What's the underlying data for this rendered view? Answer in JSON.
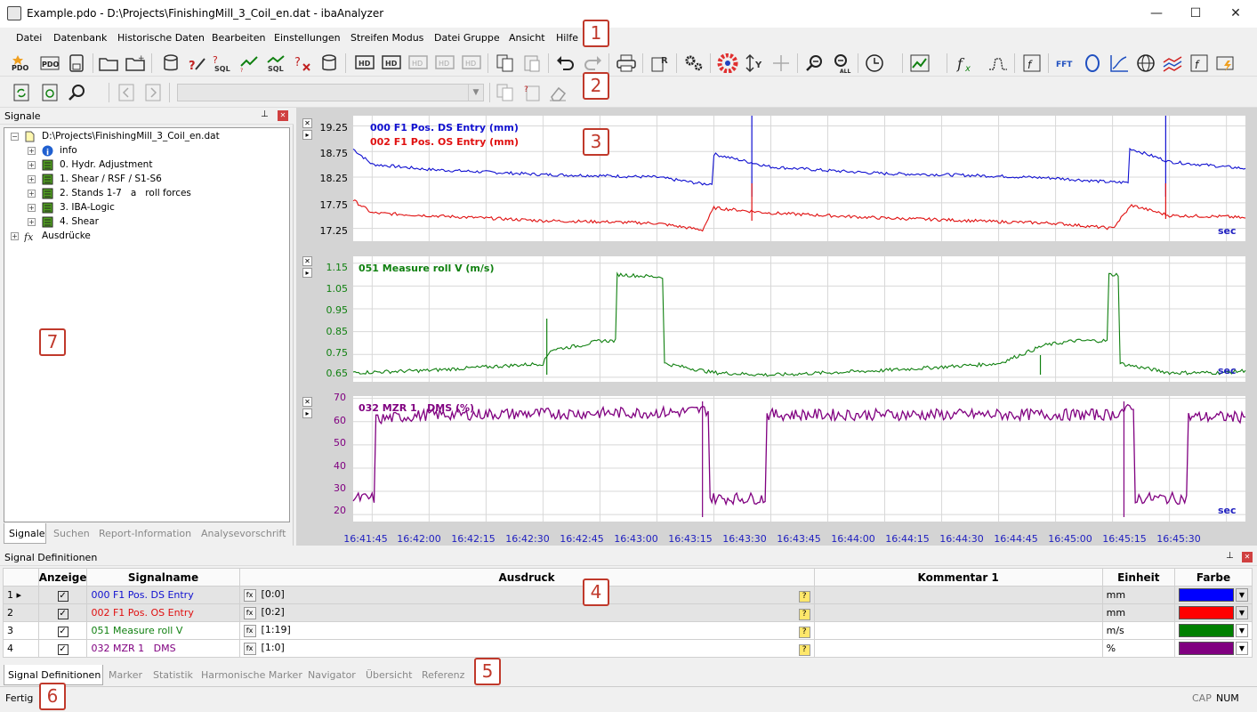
{
  "window": {
    "title": "Example.pdo - D:\\Projects\\FinishingMill_3_Coil_en.dat - ibaAnalyzer",
    "minimize": "—",
    "maximize": "☐",
    "close": "✕"
  },
  "menu": [
    "Datei",
    "Datenbank",
    "Historische Daten",
    "Bearbeiten",
    "Einstellungen",
    "Streifen Modus",
    "Datei Gruppe",
    "Ansicht",
    "Hilfe"
  ],
  "callouts": [
    "1",
    "2",
    "3",
    "4",
    "5",
    "6",
    "7"
  ],
  "signals_panel": {
    "title": "Signale",
    "pin": "⊥",
    "close": "✕",
    "root": "D:\\Projects\\FinishingMill_3_Coil_en.dat",
    "items": [
      "info",
      "0. Hydr. Adjustment",
      "1. Shear / RSF / S1-S6",
      "2. Stands 1-7   a   roll forces",
      "3. IBA-Logic",
      "4. Shear"
    ],
    "expressions": "Ausdrücke",
    "tabs": [
      "Signale",
      "Suchen",
      "Report-Information",
      "Analysevorschrift"
    ]
  },
  "charts": {
    "colors": {
      "blue": "#1010d0",
      "red": "#e01010",
      "green": "#108010",
      "purple": "#800080"
    },
    "sec_label": "sec",
    "x_ticks": [
      "16:41:45",
      "16:42:00",
      "16:42:15",
      "16:42:30",
      "16:42:45",
      "16:43:00",
      "16:43:15",
      "16:43:30",
      "16:43:45",
      "16:44:00",
      "16:44:15",
      "16:44:30",
      "16:44:45",
      "16:45:00",
      "16:45:15",
      "16:45:30"
    ],
    "chart1": {
      "y_ticks": [
        "19.25",
        "18.75",
        "18.25",
        "17.75",
        "17.25"
      ],
      "legend": [
        "000 F1 Pos. DS Entry (mm)",
        "002 F1 Pos. OS Entry (mm)"
      ]
    },
    "chart2": {
      "y_ticks": [
        "1.15",
        "1.05",
        "0.95",
        "0.85",
        "0.75",
        "0.65"
      ],
      "legend": [
        "051 Measure roll V (m/s)"
      ]
    },
    "chart3": {
      "y_ticks": [
        "70",
        "60",
        "50",
        "40",
        "30",
        "20"
      ],
      "legend": [
        "032 MZR 1   DMS (%)"
      ]
    }
  },
  "chart_data": [
    {
      "type": "line",
      "title": "",
      "xlabel": "",
      "ylabel": "",
      "ylim": [
        17.0,
        19.45
      ],
      "y_ticks": [
        19.25,
        18.75,
        18.25,
        17.75,
        17.25
      ],
      "x": [
        "16:41:40",
        "16:41:45",
        "16:42:00",
        "16:42:15",
        "16:42:30",
        "16:42:45",
        "16:43:00",
        "16:43:12",
        "16:43:15",
        "16:43:30",
        "16:43:45",
        "16:44:00",
        "16:44:15",
        "16:44:30",
        "16:44:45",
        "16:45:00",
        "16:45:05",
        "16:45:15",
        "16:45:30",
        "16:45:35"
      ],
      "series": [
        {
          "name": "000 F1 Pos. DS Entry (mm)",
          "values": [
            18.8,
            18.5,
            18.4,
            18.35,
            18.3,
            18.28,
            18.25,
            18.12,
            18.7,
            18.45,
            18.38,
            18.32,
            18.3,
            18.27,
            18.23,
            18.15,
            18.8,
            18.55,
            18.45,
            18.42
          ]
        },
        {
          "name": "002 F1 Pos. OS Entry (mm)",
          "values": [
            17.8,
            17.55,
            17.5,
            17.45,
            17.4,
            17.38,
            17.35,
            17.22,
            17.65,
            17.55,
            17.5,
            17.45,
            17.42,
            17.38,
            17.35,
            17.25,
            17.7,
            17.5,
            17.48,
            17.45
          ]
        }
      ]
    },
    {
      "type": "line",
      "title": "",
      "xlabel": "",
      "ylabel": "",
      "ylim": [
        0.63,
        1.18
      ],
      "y_ticks": [
        1.15,
        1.05,
        0.95,
        0.85,
        0.75,
        0.65
      ],
      "x": [
        "16:41:40",
        "16:42:00",
        "16:42:30",
        "16:42:32",
        "16:42:40",
        "16:42:45",
        "16:42:50",
        "16:43:00",
        "16:43:02",
        "16:43:15",
        "16:43:30",
        "16:44:00",
        "16:44:30",
        "16:44:42",
        "16:44:50",
        "16:45:00",
        "16:45:02",
        "16:45:15",
        "16:45:30",
        "16:45:35"
      ],
      "series": [
        {
          "name": "051 Measure roll V (m/s)",
          "values": [
            0.67,
            0.68,
            0.71,
            0.77,
            0.79,
            0.81,
            1.1,
            1.09,
            0.71,
            0.67,
            0.66,
            0.68,
            0.71,
            0.79,
            0.81,
            1.1,
            0.71,
            0.67,
            0.67,
            0.68
          ]
        }
      ]
    },
    {
      "type": "line",
      "title": "",
      "xlabel": "",
      "ylabel": "",
      "ylim": [
        17,
        71
      ],
      "y_ticks": [
        70,
        60,
        50,
        40,
        30,
        20
      ],
      "x": [
        "16:41:40",
        "16:41:45",
        "16:41:46",
        "16:42:00",
        "16:43:05",
        "16:43:12",
        "16:43:14",
        "16:43:28",
        "16:43:29",
        "16:44:00",
        "16:45:00",
        "16:45:03",
        "16:45:06",
        "16:45:19",
        "16:45:20",
        "16:45:35"
      ],
      "series": [
        {
          "name": "032 MZR 1   DMS (%)",
          "values": [
            27,
            27,
            61,
            63,
            64,
            65,
            27,
            27,
            63,
            63,
            63,
            65,
            27,
            27,
            62,
            62
          ]
        }
      ]
    }
  ],
  "definitions": {
    "title": "Signal Definitionen",
    "pin": "⊥",
    "close": "✕",
    "columns": [
      "Anzeige",
      "Signalname",
      "Ausdruck",
      "Kommentar 1",
      "Einheit",
      "Farbe"
    ],
    "rows": [
      {
        "idx": "1 ▸",
        "check": "✓",
        "name": "000 F1 Pos. DS Entry",
        "fx": "fx",
        "expr": "[0:0]",
        "q": "?",
        "comment": "",
        "unit": "mm",
        "color": "#0000ff",
        "textcolor": "#1010d0"
      },
      {
        "idx": "2",
        "check": "✓",
        "name": "002 F1 Pos. OS Entry",
        "fx": "fx",
        "expr": "[0:2]",
        "q": "?",
        "comment": "",
        "unit": "mm",
        "color": "#ff0000",
        "textcolor": "#e01010"
      },
      {
        "idx": "3",
        "check": "✓",
        "name": "051 Measure roll V",
        "fx": "fx",
        "expr": "[1:19]",
        "q": "?",
        "comment": "",
        "unit": "m/s",
        "color": "#008000",
        "textcolor": "#108010"
      },
      {
        "idx": "4",
        "check": "✓",
        "name": "032 MZR 1   DMS",
        "fx": "fx",
        "expr": "[1:0]",
        "q": "?",
        "comment": "",
        "unit": "%",
        "color": "#800080",
        "textcolor": "#800080"
      }
    ],
    "tabs": [
      "Signal Definitionen",
      "Marker",
      "Statistik",
      "Harmonische Marker",
      "Navigator",
      "Übersicht",
      "Referenz"
    ]
  },
  "status": {
    "text": "Fertig",
    "caps": "CAP",
    "num": "NUM"
  }
}
